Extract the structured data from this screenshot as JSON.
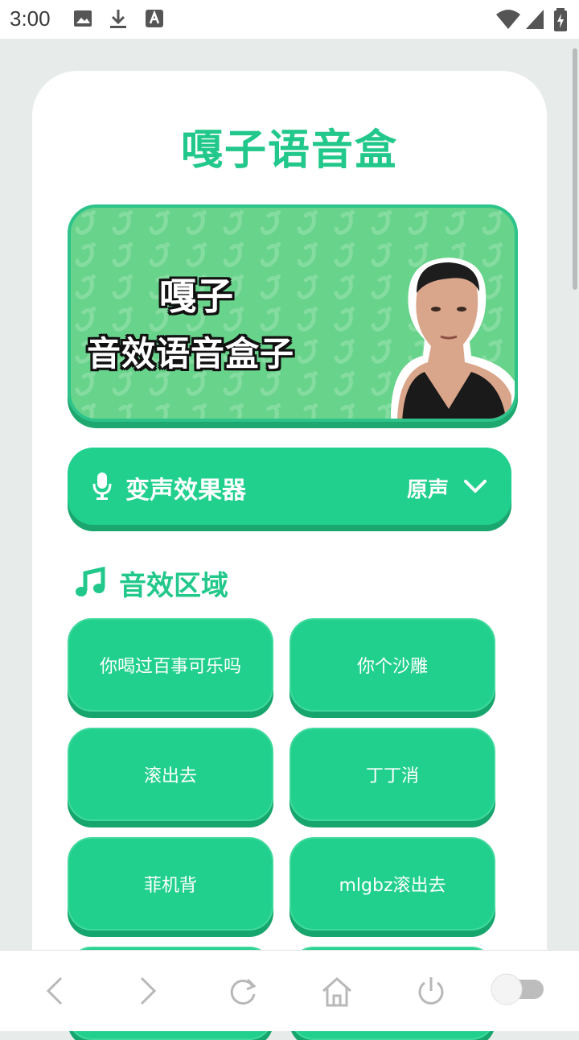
{
  "status_bar": {
    "time": "3:00"
  },
  "app": {
    "title": "嘎子语音盒"
  },
  "banner": {
    "line1": "嘎子",
    "line2": "音效语音盒子"
  },
  "voice_changer": {
    "label": "变声效果器",
    "value": "原声"
  },
  "section": {
    "title": "音效区域"
  },
  "sounds": [
    "你喝过百事可乐吗",
    "你个沙雕",
    "滚出去",
    "丁丁消",
    "菲机背",
    "mlgbz滚出去"
  ],
  "colors": {
    "accent": "#22d08e",
    "title": "#22c88b",
    "banner": "#68d38a"
  }
}
